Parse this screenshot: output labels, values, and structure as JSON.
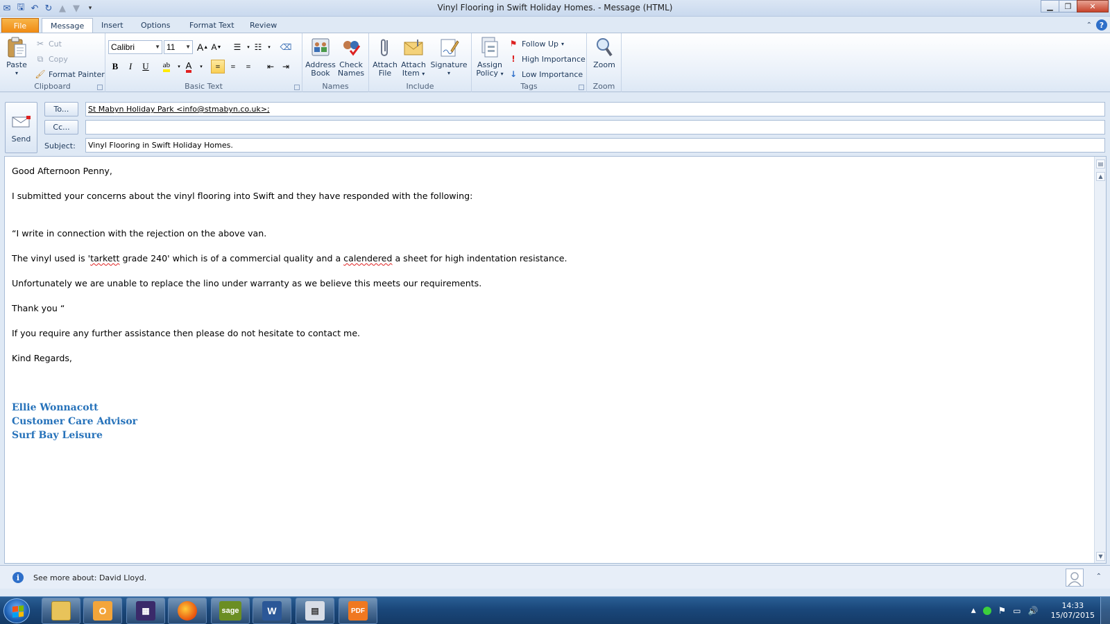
{
  "window": {
    "title": "Vinyl Flooring in Swift Holiday Homes.  -  Message (HTML)"
  },
  "tabs": [
    {
      "label": "File"
    },
    {
      "label": "Message"
    },
    {
      "label": "Insert"
    },
    {
      "label": "Options"
    },
    {
      "label": "Format Text"
    },
    {
      "label": "Review"
    }
  ],
  "ribbon": {
    "clipboard": {
      "label": "Clipboard",
      "paste": "Paste",
      "cut": "Cut",
      "copy": "Copy",
      "format_painter": "Format Painter"
    },
    "basic_text": {
      "label": "Basic Text",
      "font": "Calibri",
      "size": "11",
      "bold": "B",
      "italic": "I",
      "underline": "U"
    },
    "names": {
      "label": "Names",
      "address_book_1": "Address",
      "address_book_2": "Book",
      "check_names_1": "Check",
      "check_names_2": "Names"
    },
    "include": {
      "label": "Include",
      "attach_file_1": "Attach",
      "attach_file_2": "File",
      "attach_item_1": "Attach",
      "attach_item_2": "Item",
      "signature": "Signature"
    },
    "tags": {
      "label": "Tags",
      "assign_policy_1": "Assign",
      "assign_policy_2": "Policy",
      "follow_up": "Follow Up",
      "high_importance": "High Importance",
      "low_importance": "Low Importance"
    },
    "zoom": {
      "label": "Zoom",
      "zoom": "Zoom"
    }
  },
  "header": {
    "send": "Send",
    "to_button": "To...",
    "cc_button": "Cc...",
    "subject_label": "Subject:",
    "to_value": "St Mabyn Holiday Park <info@stmabyn.co.uk>;",
    "cc_value": "",
    "subject_value": "Vinyl Flooring in Swift Holiday Homes."
  },
  "body": {
    "greeting": "Good Afternoon Penny,",
    "p1": "I submitted your concerns about the vinyl flooring into Swift and they have responded with the following:",
    "p2": "“I write in connection with the rejection on the above van.",
    "p3_a": "The vinyl used is '",
    "p3_b": "tarkett",
    "p3_c": " grade 240' which is of a commercial quality and a ",
    "p3_d": "calendered",
    "p3_e": " a sheet for high indentation resistance.",
    "p4": "Unfortunately we are unable to replace the lino under warranty as we believe this meets our requirements.",
    "p5": "Thank you “",
    "p6": "If you require any further assistance then please do not hesitate to contact me.",
    "closing": "Kind Regards,",
    "signature": {
      "name": "Ellie Wonnacott",
      "role": "Customer Care Advisor",
      "company": "Surf Bay Leisure",
      "color": "#2672ba"
    }
  },
  "people_pane": {
    "text": "See more about: David Lloyd."
  },
  "taskbar": {
    "apps": [
      {
        "icon": "file-explorer-icon"
      },
      {
        "icon": "outlook-icon"
      },
      {
        "icon": "calendar-app-icon"
      },
      {
        "icon": "firefox-icon"
      },
      {
        "icon": "sage-icon",
        "label": "sage"
      },
      {
        "icon": "word-icon",
        "label": "W"
      },
      {
        "icon": "calculator-icon"
      },
      {
        "icon": "pdf-icon",
        "label": "PDF"
      }
    ],
    "time": "14:33",
    "date": "15/07/2015"
  }
}
